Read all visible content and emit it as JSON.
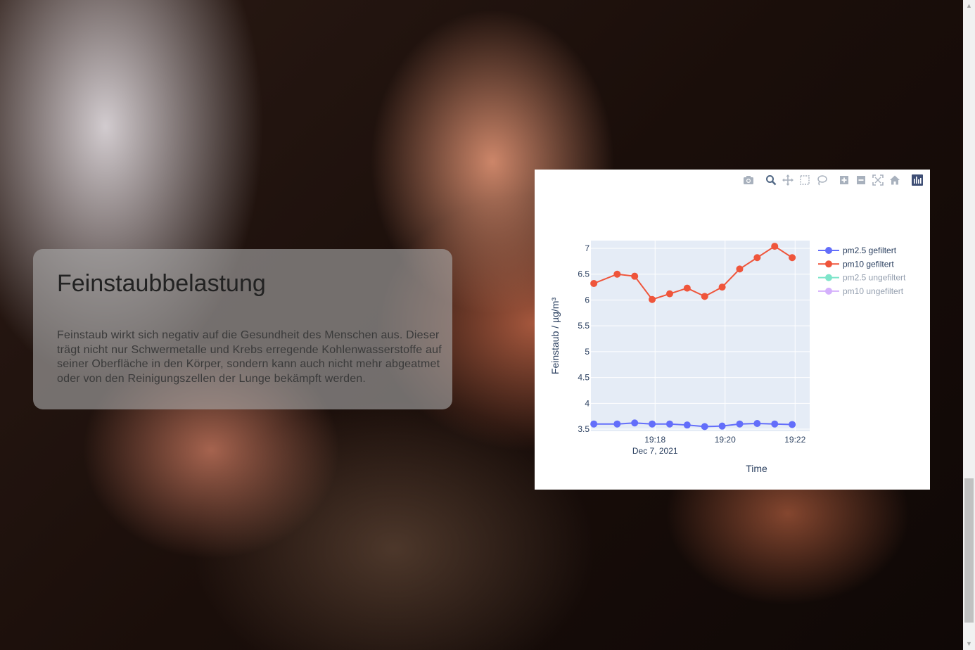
{
  "info": {
    "title": "Feinstaubbelastung",
    "text": "Feinstaub wirkt sich negativ auf die Gesundheit des Menschen aus. Dieser trägt nicht nur Schwermetalle und Krebs erregende Kohlenwasserstoffe auf seiner Oberfläche in den Körper, sondern kann auch nicht mehr abgeatmet oder von den Reinigungszellen der Lunge bekämpft werden."
  },
  "modebar": {
    "buttons": [
      "camera-icon",
      "zoom-icon",
      "pan-icon",
      "box-select-icon",
      "lasso-select-icon",
      "zoom-in-icon",
      "zoom-out-icon",
      "autoscale-icon",
      "reset-axes-icon",
      "plotly-logo-icon"
    ]
  },
  "colors": {
    "plot_bg": "#e5ecf6",
    "pm25_filtered": "#636efa",
    "pm10_filtered": "#ef553b",
    "pm25_unfiltered": "#00cc96",
    "pm10_unfiltered": "#ab63fa",
    "axis_text": "#2a3f5f",
    "card_bg": "rgba(170,170,170,0.62)"
  },
  "chart_data": {
    "type": "line",
    "title": "",
    "xlabel": "Time",
    "ylabel": "Feinstaub / µg/m³",
    "x_ticks": [
      "19:18",
      "19:20",
      "19:22"
    ],
    "x_tick_sub": "Dec 7, 2021",
    "xlim": [
      "2021-12-07 19:16:10",
      "2021-12-07 19:22:25"
    ],
    "ylim": [
      3.46,
      7.15
    ],
    "y_ticks": [
      3.5,
      4,
      4.5,
      5,
      5.5,
      6,
      6.5,
      7
    ],
    "x": [
      "2021-12-07 19:16:15",
      "2021-12-07 19:16:55",
      "2021-12-07 19:17:25",
      "2021-12-07 19:17:55",
      "2021-12-07 19:18:25",
      "2021-12-07 19:18:55",
      "2021-12-07 19:19:25",
      "2021-12-07 19:19:55",
      "2021-12-07 19:20:25",
      "2021-12-07 19:20:55",
      "2021-12-07 19:21:25",
      "2021-12-07 19:21:55"
    ],
    "series": [
      {
        "name": "pm2.5 gefiltert",
        "visible": true,
        "values": [
          3.6,
          3.6,
          3.62,
          3.6,
          3.6,
          3.58,
          3.55,
          3.56,
          3.6,
          3.61,
          3.6,
          3.59
        ]
      },
      {
        "name": "pm10 gefiltert",
        "visible": true,
        "values": [
          6.32,
          6.5,
          6.46,
          6.01,
          6.12,
          6.23,
          6.07,
          6.25,
          6.6,
          6.82,
          7.04,
          6.82
        ]
      },
      {
        "name": "pm2.5 ungefiltert",
        "visible": false,
        "values": []
      },
      {
        "name": "pm10 ungefiltert",
        "visible": false,
        "values": []
      }
    ],
    "grid": true,
    "legend_position": "right"
  }
}
